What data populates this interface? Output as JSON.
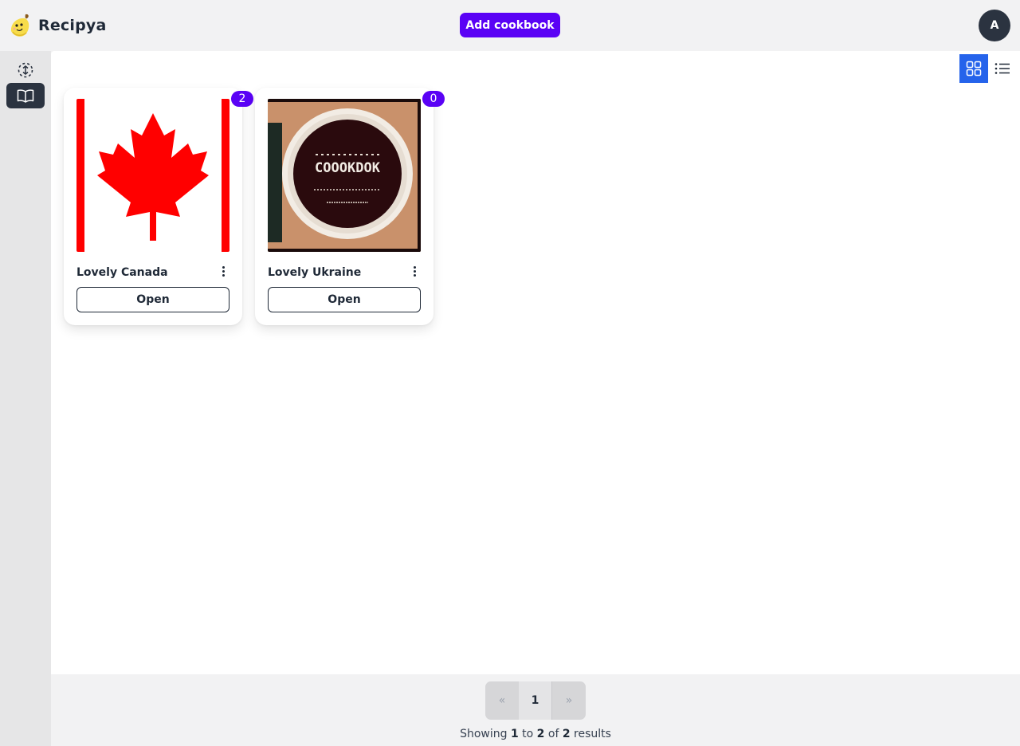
{
  "app": {
    "name": "Recipya",
    "logo_icon": "banana-mascot-icon"
  },
  "header": {
    "add_button_label": "Add cookbook",
    "avatar_initial": "A"
  },
  "sidebar": {
    "items": [
      {
        "name": "sidebar-item-recipes",
        "icon": "dashed-arrows-icon",
        "active": false
      },
      {
        "name": "sidebar-item-cookbooks",
        "icon": "book-open-icon",
        "active": true
      }
    ]
  },
  "view_toggle": {
    "active": "grid",
    "options": [
      "grid-icon",
      "list-icon"
    ]
  },
  "cookbooks": [
    {
      "title": "Lovely Canada",
      "count": "2",
      "open_label": "Open",
      "image": "canada-flag"
    },
    {
      "title": "Lovely Ukraine",
      "count": "0",
      "open_label": "Open",
      "image": "cookbook-plate",
      "image_text": "COOOKDOK"
    }
  ],
  "pagination": {
    "prev": "«",
    "current": "1",
    "next": "»"
  },
  "results": {
    "prefix": "Showing",
    "from": "1",
    "to_word": "to",
    "to": "2",
    "of_word": "of",
    "total": "2",
    "suffix": "results"
  },
  "colors": {
    "accent": "#5a02f5",
    "active_toggle": "#2563eb",
    "dark": "#2b3340"
  }
}
